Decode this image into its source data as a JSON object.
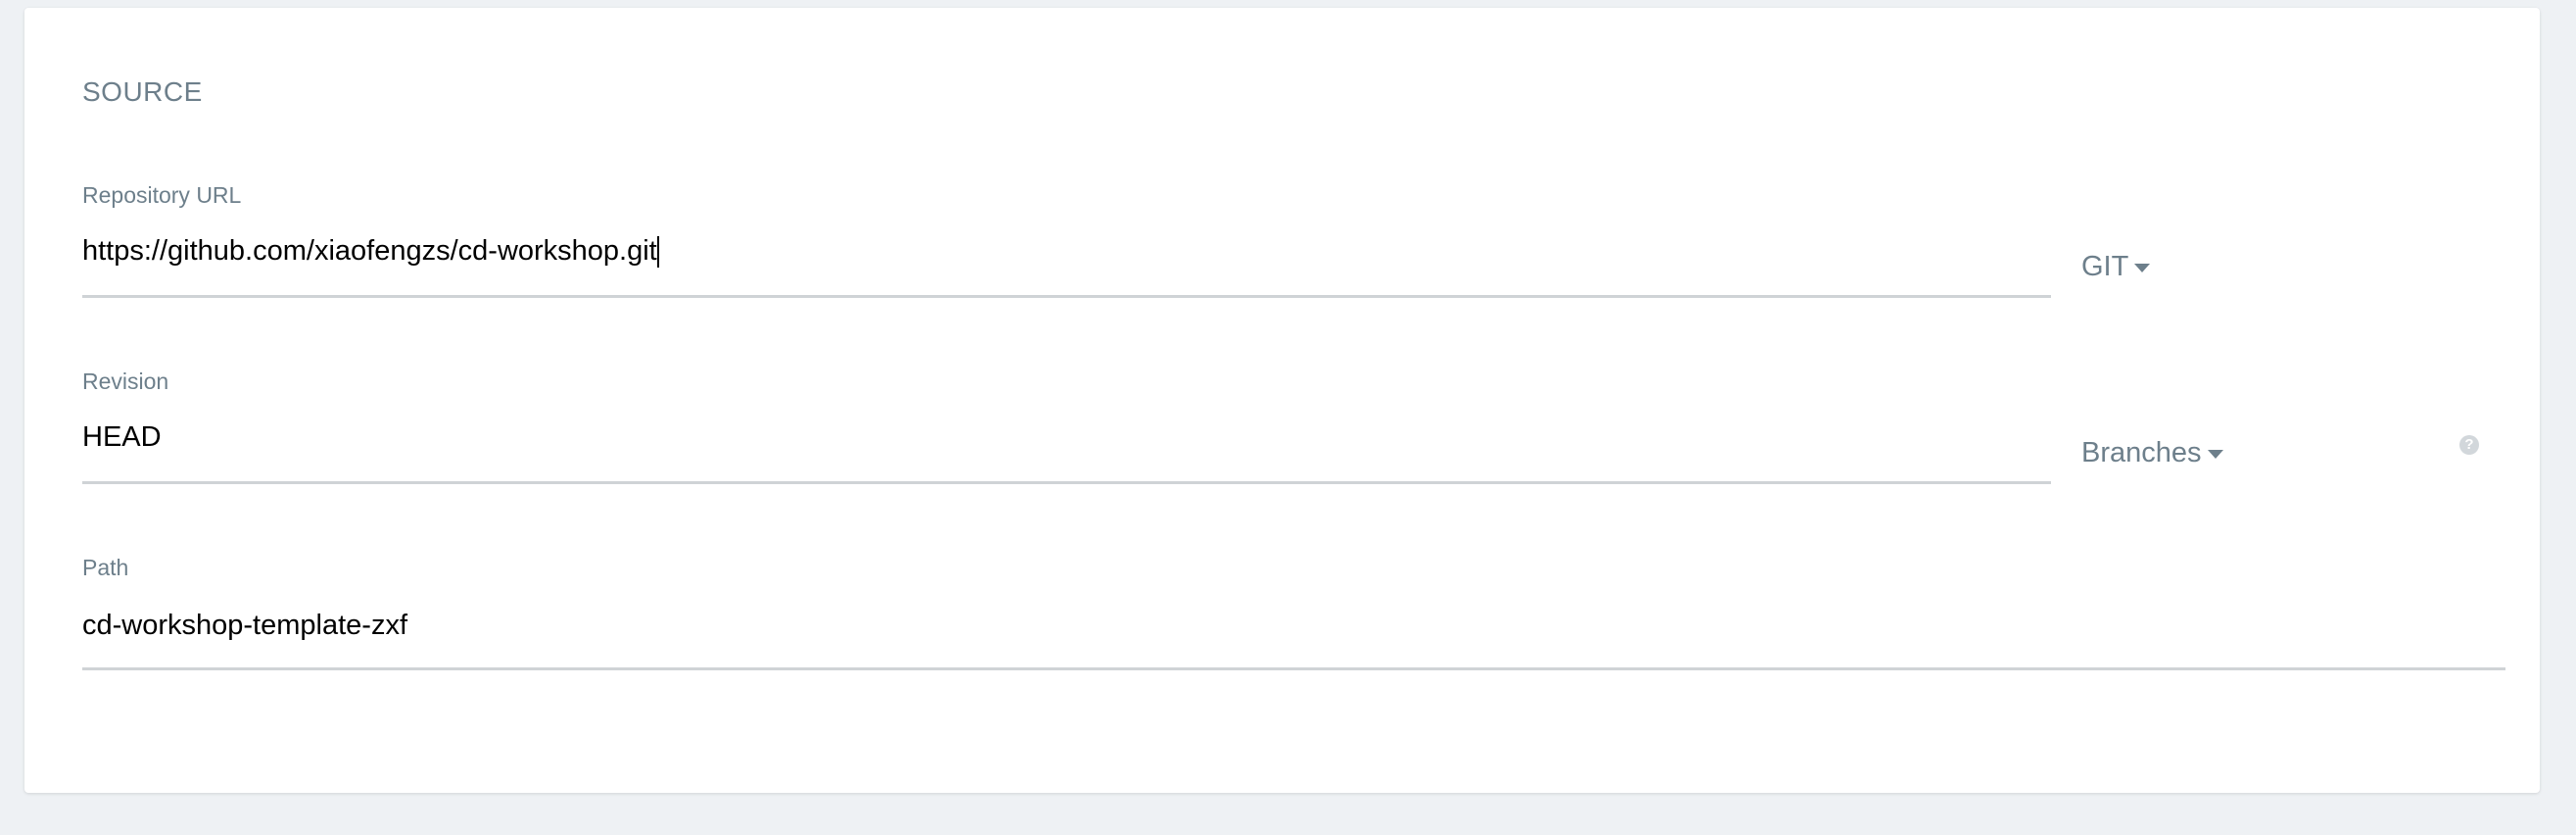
{
  "source": {
    "title": "SOURCE",
    "repository": {
      "label": "Repository URL",
      "value": "https://github.com/xiaofengzs/cd-workshop.git",
      "type_label": "GIT"
    },
    "revision": {
      "label": "Revision",
      "value": "HEAD",
      "mode_label": "Branches",
      "help_icon": "question-mark"
    },
    "path": {
      "label": "Path",
      "value": "cd-workshop-template-zxf"
    }
  }
}
